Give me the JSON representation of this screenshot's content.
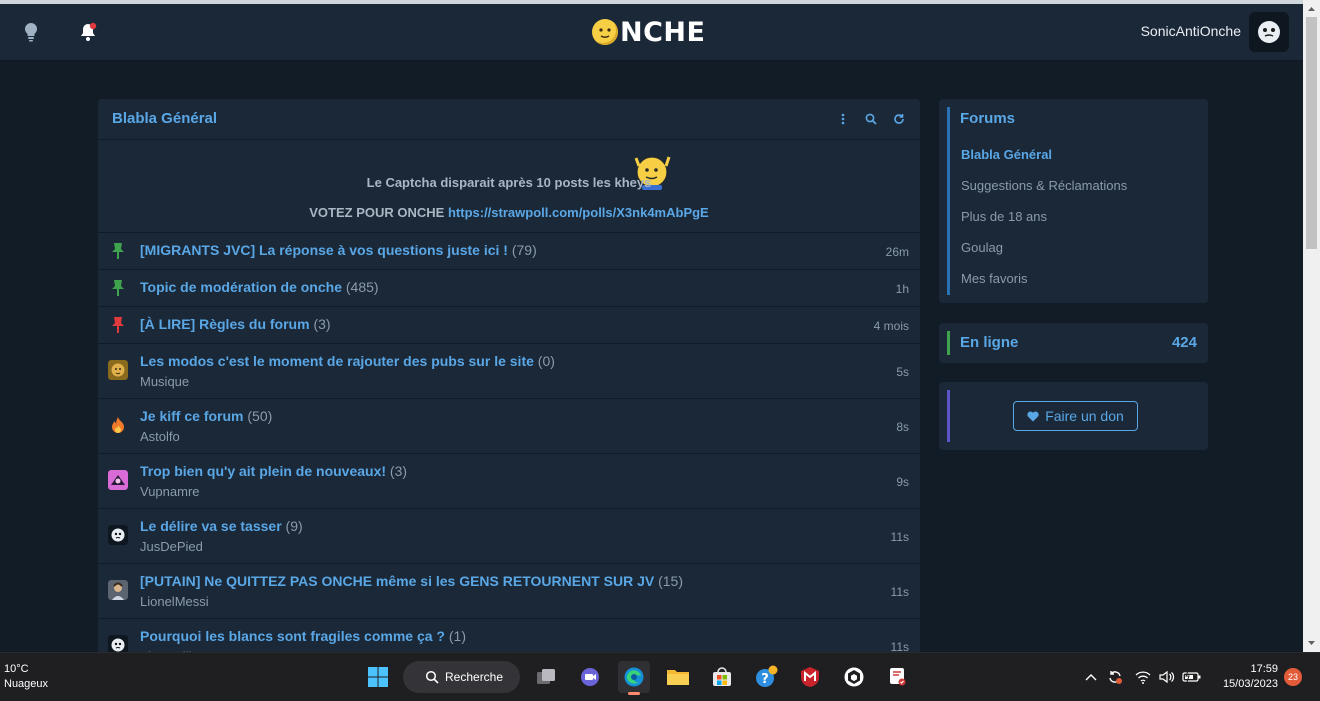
{
  "header": {
    "logo_text": "NCHE",
    "username": "SonicAntiOnche",
    "icons": [
      "bulb-icon",
      "bell-icon"
    ]
  },
  "main": {
    "title": "Blabla Général",
    "header_icons": [
      "more-vertical-icon",
      "search-icon",
      "refresh-icon"
    ],
    "notice_line1": "Le Captcha disparait après 10 posts les kheys",
    "notice_line2_prefix": "VOTEZ POUR ONCHE",
    "notice_link": "https://strawpoll.com/polls/X3nk4mAbPgE",
    "topics": [
      {
        "title": "[MIGRANTS JVC] La réponse à vos questions juste ici !",
        "count": "(79)",
        "author": "",
        "time": "26m",
        "icon": "pin-green-icon"
      },
      {
        "title": "Topic de modération de onche",
        "count": "(485)",
        "author": "",
        "time": "1h",
        "icon": "pin-green-icon"
      },
      {
        "title": "[À LIRE] Règles du forum",
        "count": "(3)",
        "author": "",
        "time": "4 mois",
        "icon": "pin-red-icon"
      },
      {
        "title": "Les modos c'est le moment de rajouter des pubs sur le site",
        "count": "(0)",
        "author": "Musique",
        "time": "5s",
        "icon": "avatar-lion-icon"
      },
      {
        "title": "Je kiff ce forum",
        "count": "(50)",
        "author": "Astolfo",
        "time": "8s",
        "icon": "flame-icon"
      },
      {
        "title": "Trop bien qu'y ait plein de nouveaux!",
        "count": "(3)",
        "author": "Vupnamre",
        "time": "9s",
        "icon": "avatar-pink-icon"
      },
      {
        "title": "Le délire va se tasser",
        "count": "(9)",
        "author": "JusDePied",
        "time": "11s",
        "icon": "avatar-face-icon"
      },
      {
        "title": "[PUTAIN] Ne QUITTEZ PAS ONCHE même si les GENS RETOURNENT SUR JV",
        "count": "(15)",
        "author": "LionelMessi",
        "time": "11s",
        "icon": "avatar-messi-icon"
      },
      {
        "title": "Pourquoi les blancs sont fragiles comme ça ?",
        "count": "(1)",
        "author": "Fizzarolli",
        "time": "11s",
        "icon": "avatar-face-icon"
      }
    ]
  },
  "sidebar": {
    "forums_title": "Forums",
    "forums": [
      {
        "label": "Blabla Général",
        "active": true
      },
      {
        "label": "Suggestions & Réclamations",
        "active": false
      },
      {
        "label": "Plus de 18 ans",
        "active": false
      },
      {
        "label": "Goulag",
        "active": false
      },
      {
        "label": "Mes favoris",
        "active": false
      }
    ],
    "online_label": "En ligne",
    "online_count": "424",
    "donate_label": "Faire un don"
  },
  "taskbar": {
    "weather_temp": "10°C",
    "weather_desc": "Nuageux",
    "search_label": "Recherche",
    "time": "17:59",
    "date": "15/03/2023",
    "notification_count": "23"
  },
  "colors": {
    "accent": "#5aa7e6",
    "panel": "#1b2838",
    "background": "#121c27",
    "muted": "#8a9bab"
  }
}
